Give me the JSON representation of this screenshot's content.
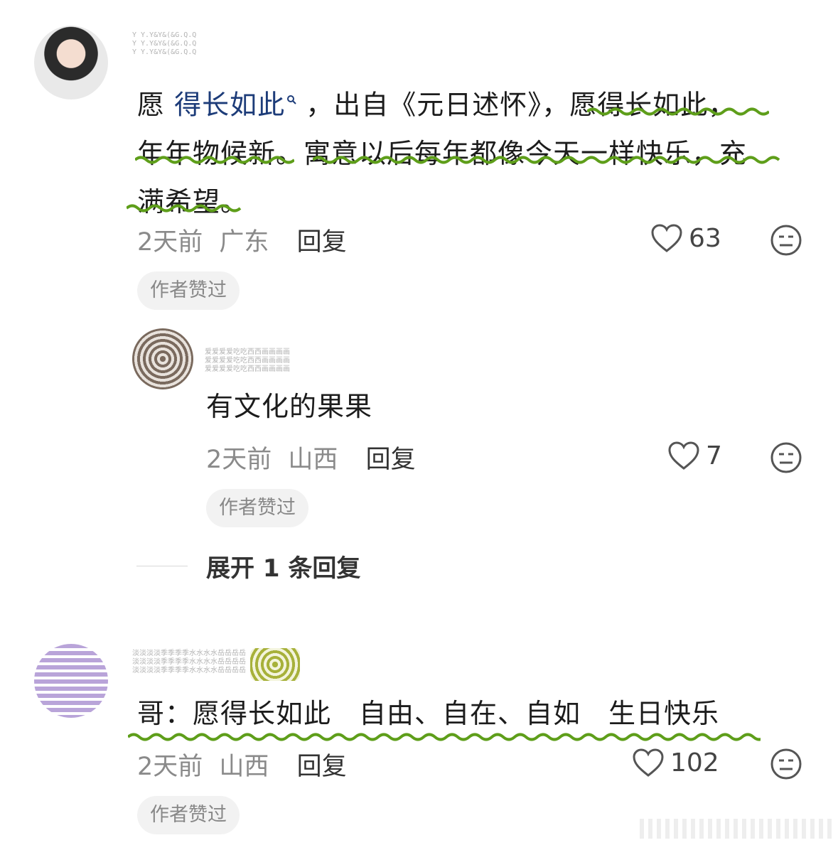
{
  "comments": [
    {
      "username": "Y Y.Y&Y&(&G.Q.Q",
      "text_prefix": "愿 ",
      "keyword": "得长如此",
      "text_line1_rest": " ，出自《元日述怀》，愿得长如此，",
      "text_line2": "年年物候新。寓意以后每年都像今天一样快乐，充",
      "text_line3": "满希望。",
      "time": "2天前",
      "location": "广东",
      "reply_label": "回复",
      "likes": "63",
      "badge": "作者赞过"
    },
    {
      "username": "爱爱爱爱吃吃西西画画画画",
      "text": "有文化的果果",
      "time": "2天前",
      "location": "山西",
      "reply_label": "回复",
      "likes": "7",
      "badge": "作者赞过"
    },
    {
      "username": "淡淡淡淡季季季季水水水水岳岳岳岳",
      "text": "哥：愿得长如此　自由、自在、自如　生日快乐",
      "time": "2天前",
      "location": "山西",
      "reply_label": "回复",
      "likes": "102",
      "badge": "作者赞过"
    }
  ],
  "expand_replies": "展开 1 条回复",
  "colors": {
    "underline": "#5e9e1a",
    "keyword": "#1d3c79",
    "badge_bg": "#f2f2f2"
  },
  "icons": [
    "heart-icon",
    "neutral-face-icon",
    "search-icon"
  ]
}
